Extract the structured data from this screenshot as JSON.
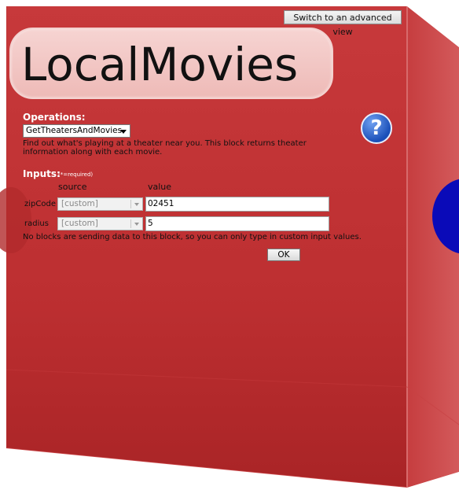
{
  "header": {
    "advanced_view_label": "Switch to an advanced view"
  },
  "app": {
    "title": "LocalMovies"
  },
  "operations": {
    "label": "Operations:",
    "selected": "GetTheatersAndMovies",
    "description": "Find out what's playing at a theater near you. This block returns theater information along with each movie."
  },
  "inputs": {
    "label": "Inputs:",
    "required_note": "(*=required)",
    "columns": {
      "source": "source",
      "value": "value"
    },
    "rows": [
      {
        "name": "zipCode",
        "source": "[custom]",
        "value": "02451"
      },
      {
        "name": "radius",
        "source": "[custom]",
        "value": "5"
      }
    ],
    "note": "No blocks are sending data to this block, so you can only type in custom input values.",
    "ok_label": "OK"
  },
  "colors": {
    "cube_red": "#c8373a",
    "help_blue": "#1a4fb8",
    "side_ball": "#0a0ab8"
  }
}
